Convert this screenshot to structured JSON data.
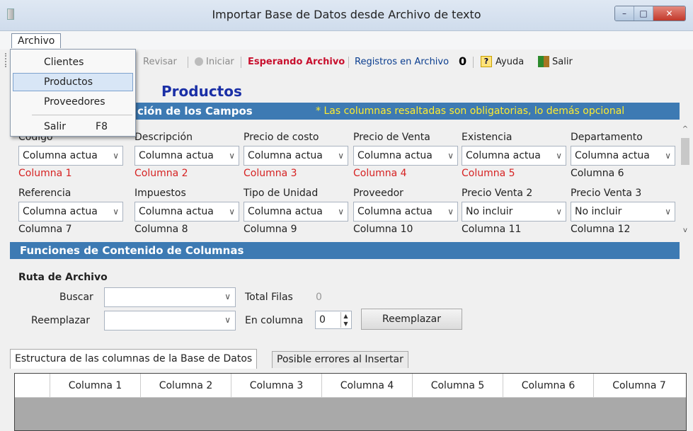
{
  "window": {
    "title": "Importar Base de Datos desde Archivo de texto",
    "min": "–",
    "max": "□",
    "close": "✕"
  },
  "menu": {
    "archivo": "Archivo",
    "items": [
      {
        "label": "Clientes",
        "shortcut": ""
      },
      {
        "label": "Productos",
        "shortcut": ""
      },
      {
        "label": "Proveedores",
        "shortcut": ""
      },
      {
        "label": "Salir",
        "shortcut": "F8"
      }
    ]
  },
  "toolbar": {
    "revisar": "Revisar",
    "iniciar": "Iniciar",
    "status": "Esperando Archivo",
    "registros_label": "Registros en Archivo",
    "registros_count": "0",
    "ayuda": "Ayuda",
    "salir": "Salir",
    "help_glyph": "?"
  },
  "heading": "Productos",
  "section1": {
    "title": "ción de los Campos",
    "note": "* Las columnas resaltadas son obligatorias, lo demás opcional"
  },
  "fields_row1": [
    {
      "label": "Código",
      "select": "Columna actua",
      "column": "Columna 1",
      "required": true
    },
    {
      "label": "Descripción",
      "select": "Columna actua",
      "column": "Columna 2",
      "required": true
    },
    {
      "label": "Precio de costo",
      "select": "Columna actua",
      "column": "Columna 3",
      "required": true
    },
    {
      "label": "Precio de Venta",
      "select": "Columna actua",
      "column": "Columna 4",
      "required": true
    },
    {
      "label": "Existencia",
      "select": "Columna actua",
      "column": "Columna 5",
      "required": true
    },
    {
      "label": "Departamento",
      "select": "Columna actua",
      "column": "Columna 6",
      "required": false
    }
  ],
  "fields_row2": [
    {
      "label": "Referencia",
      "select": "Columna actua",
      "column": "Columna 7",
      "required": false
    },
    {
      "label": "Impuestos",
      "select": "Columna actua",
      "column": "Columna 8",
      "required": false
    },
    {
      "label": "Tipo de Unidad",
      "select": "Columna actua",
      "column": "Columna 9",
      "required": false
    },
    {
      "label": "Proveedor",
      "select": "Columna actua",
      "column": "Columna 10",
      "required": false
    },
    {
      "label": "Precio Venta 2",
      "select": "No incluir",
      "column": "Columna 11",
      "required": false
    },
    {
      "label": "Precio Venta 3",
      "select": "No incluir",
      "column": "Columna 12",
      "required": false
    }
  ],
  "section2": {
    "title": "Funciones de Contenido de Columnas"
  },
  "ruta": {
    "title": "Ruta de Archivo",
    "buscar_label": "Buscar",
    "reemplazar_label": "Reemplazar",
    "total_filas_label": "Total Filas",
    "total_filas_value": "0",
    "en_columna_label": "En columna",
    "en_columna_value": "0",
    "reemplazar_button": "Reemplazar"
  },
  "tabs": [
    {
      "label": "Estructura de las columnas de la Base de Datos",
      "active": true
    },
    {
      "label": "Posible errores al Insertar",
      "active": false
    }
  ],
  "grid": {
    "columns": [
      "Columna 1",
      "Columna 2",
      "Columna 3",
      "Columna 4",
      "Columna 5",
      "Columna 6",
      "Columna 7"
    ]
  },
  "colors": {
    "band": "#3d7ab3",
    "note": "#ffec2e",
    "required": "#d62222",
    "heading": "#1a2fa6",
    "status": "#c8102e"
  }
}
